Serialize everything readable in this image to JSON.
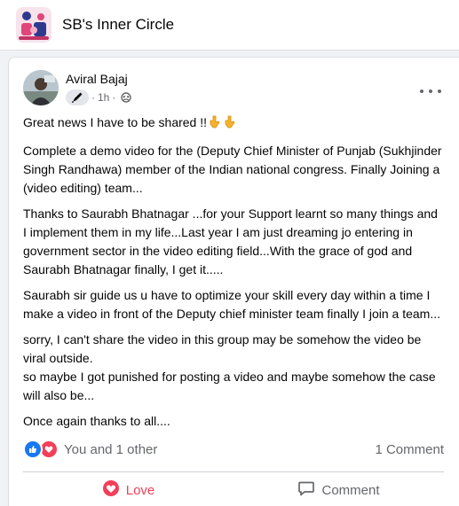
{
  "group": {
    "name": "SB's Inner Circle"
  },
  "post": {
    "author": "Aviral Bajaj",
    "time": "1h",
    "separator": "·",
    "paragraphs": {
      "p1": "Great news I have to be shared !!",
      "p2": "Complete a demo video for the (Deputy Chief Minister of Punjab (Sukhjinder Singh Randhawa) member of the Indian national congress. Finally Joining a  (video editing) team...",
      "p3": "Thanks to Saurabh Bhatnagar ...for your Support learnt so many things and I implement them in my life...Last year I am just dreaming jo entering in government sector in the video editing field...With the grace of god and Saurabh Bhatnagar finally, I get it.....",
      "p4": "Saurabh sir guide us u have to optimize your skill every day within a time I make a video in front of the Deputy chief minister team finally I join a team...",
      "p5a": "sorry, I can't share the video in this group may be somehow the video be viral outside.",
      "p5b": "so maybe I got punished for posting a video and maybe somehow the case will also be...",
      "p6": "Once again thanks to all...."
    },
    "reactions": {
      "summary": "You and 1 other",
      "types": [
        "like-icon",
        "love-icon"
      ]
    },
    "comment_count": "1 Comment",
    "actions": {
      "love": "Love",
      "comment": "Comment"
    }
  },
  "colors": {
    "love": "#f33e58",
    "like": "#1877f2",
    "secondary_text": "#65676b",
    "background": "#f0f2f5"
  }
}
